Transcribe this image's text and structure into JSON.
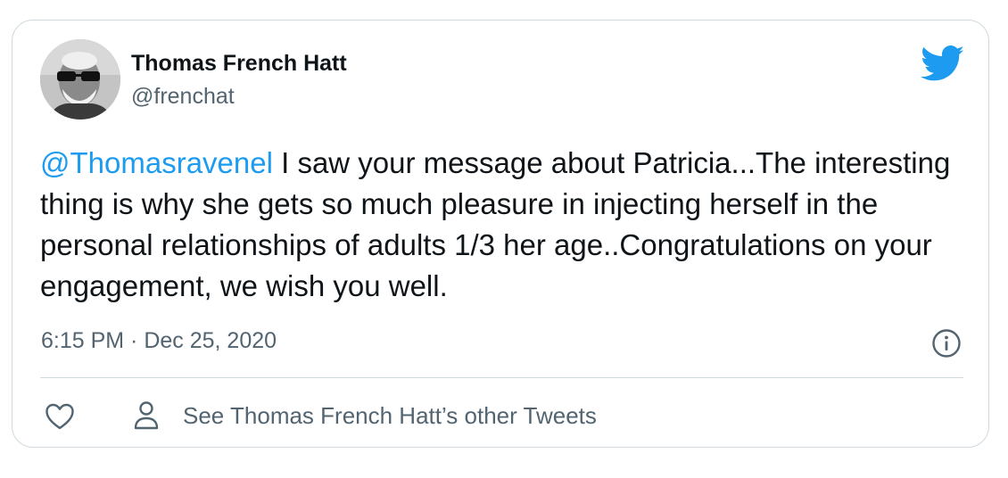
{
  "author": {
    "display_name": "Thomas French Hatt",
    "handle": "@frenchat"
  },
  "tweet": {
    "mention": "@Thomasravenel",
    "text": " I saw your message about Patricia...The interesting thing is why she gets so much pleasure in injecting herself in the personal relationships of adults 1/3 her age..Congratulations on your engagement, we wish you well.",
    "timestamp": "6:15 PM · Dec 25, 2020"
  },
  "actions": {
    "see_other_tweets": "See Thomas French Hatt’s other Tweets"
  },
  "icons": {
    "brand": "twitter-bird-icon",
    "info": "info-icon",
    "like": "heart-icon",
    "profile": "person-icon"
  },
  "colors": {
    "accent": "#1d9bf0",
    "text_primary": "#0f1419",
    "text_secondary": "#536471",
    "border": "#cfd9de"
  }
}
